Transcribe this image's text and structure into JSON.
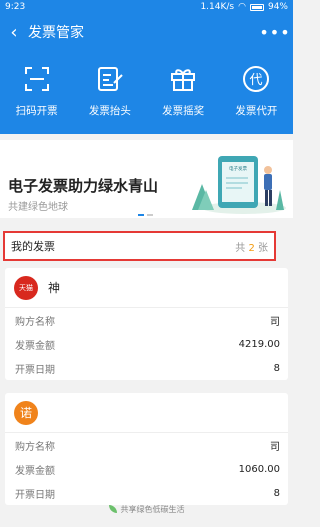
{
  "status_bar": {
    "time": "9:23",
    "network": "1.14K/s",
    "battery": "94%"
  },
  "nav": {
    "title": "发票管家"
  },
  "toolbar": {
    "items": [
      {
        "label": "扫码开票",
        "icon": "scan-icon"
      },
      {
        "label": "发票抬头",
        "icon": "edit-document-icon"
      },
      {
        "label": "发票摇奖",
        "icon": "gift-icon"
      },
      {
        "label": "发票代开",
        "icon": "proxy-issue-icon"
      }
    ]
  },
  "banner": {
    "title": "电子发票助力绿水青山",
    "subtitle": "共建绿色地球",
    "illustration_text": "电子发票"
  },
  "my_invoices": {
    "label": "我的发票",
    "count_prefix": "共",
    "count": "2",
    "count_suffix": "张"
  },
  "cards": [
    {
      "logo_text": "天猫",
      "logo_color": "#d8281e",
      "seller": "神",
      "rows": [
        {
          "label": "购方名称",
          "value": "司"
        },
        {
          "label": "发票金额",
          "value": "4219.00"
        },
        {
          "label": "开票日期",
          "value": "8"
        }
      ]
    },
    {
      "logo_text": "诺",
      "logo_color": "#f0831b",
      "seller": "",
      "rows": [
        {
          "label": "购方名称",
          "value": "司"
        },
        {
          "label": "发票金额",
          "value": "1060.00"
        },
        {
          "label": "开票日期",
          "value": "8"
        }
      ]
    }
  ],
  "footer": {
    "text": "共享绿色低碳生活"
  },
  "colors": {
    "primary": "#1e86e6",
    "highlight_border": "#e53935",
    "count_accent": "#f39c12"
  }
}
